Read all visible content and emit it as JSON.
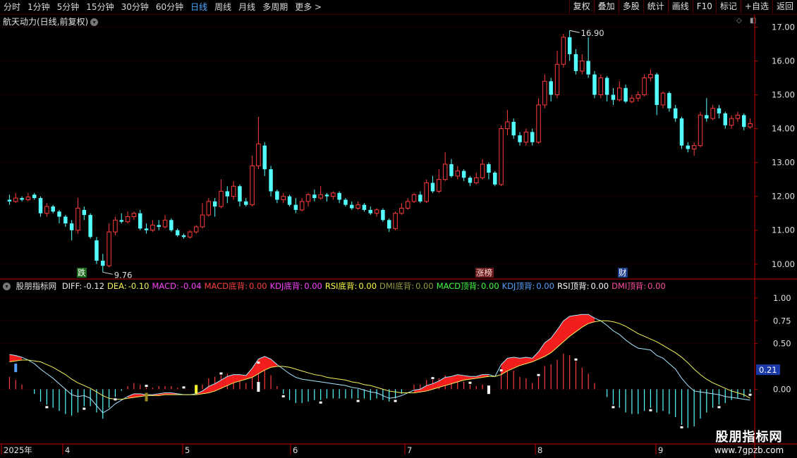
{
  "toolbar": {
    "periods": [
      "分时",
      "1分钟",
      "5分钟",
      "15分钟",
      "30分钟",
      "60分钟",
      "日线",
      "周线",
      "月线",
      "多周期",
      "更多 >"
    ],
    "active_period": "日线",
    "buttons": [
      "复权",
      "叠加",
      "多股",
      "统计",
      "画线",
      "F10",
      "标记",
      "+自选",
      "返回"
    ]
  },
  "stock": {
    "title": "航天动力(日线,前复权)"
  },
  "colors": {
    "up": "#ff3b3b",
    "down": "#54ffff",
    "diff": "#e8e8e8",
    "dea": "#f3f35a",
    "grid": "#5a0000",
    "axis": "#c00000"
  },
  "main_axis": {
    "ticks": [
      "17.00",
      "16.00",
      "15.00",
      "14.00",
      "13.00",
      "12.00",
      "11.00",
      "10.00"
    ]
  },
  "annotations": {
    "high_label": "16.90",
    "low_label": "9.76",
    "tag_die": "跌",
    "tag_zhangbang": "涨榜",
    "tag_cai": "财"
  },
  "indicator": {
    "name": "股朋指标网",
    "items": [
      {
        "label": "DIFF:",
        "value": "-0.12",
        "color": "#e8e8e8"
      },
      {
        "label": "DEA:",
        "value": "-0.10",
        "color": "#f3f35a"
      },
      {
        "label": "MACD:",
        "value": "-0.04",
        "color": "#ff44ff"
      },
      {
        "label": "MACD底背:",
        "value": "0.00",
        "color": "#ff4040"
      },
      {
        "label": "KDJ底背:",
        "value": "0.00",
        "color": "#ff44ff"
      },
      {
        "label": "RSI底背:",
        "value": "0.00",
        "color": "#ffff44"
      },
      {
        "label": "DMI底背:",
        "value": "0.00",
        "color": "#999944"
      },
      {
        "label": "MACD顶背:",
        "value": "0.00",
        "color": "#44ff44"
      },
      {
        "label": "KDJ顶背:",
        "value": "0.00",
        "color": "#5aa0ff"
      },
      {
        "label": "RSI顶背:",
        "value": "0.00",
        "color": "#ffffff"
      },
      {
        "label": "DMI顶背:",
        "value": "0.00",
        "color": "#ff4fa0"
      }
    ],
    "axis_ticks": [
      "1.00",
      "0.75",
      "0.50",
      "0.00"
    ],
    "current_value": "0.21"
  },
  "time_axis": {
    "labels": [
      "2025年",
      "4",
      "5",
      "6",
      "7",
      "8",
      "9"
    ]
  },
  "watermark": {
    "title": "股朋指标网",
    "url": "www.7gpzb.com"
  },
  "chart_data": {
    "type": "candlestick",
    "price_range": [
      9.6,
      17.3
    ],
    "indicator_range": [
      -0.6,
      1.1
    ],
    "candles": [
      [
        11.9,
        11.85,
        12.05,
        11.75
      ],
      [
        11.85,
        11.95,
        12.1,
        11.8
      ],
      [
        11.95,
        11.9,
        12.0,
        11.85
      ],
      [
        11.9,
        11.98,
        12.1,
        11.85
      ],
      [
        12.05,
        11.95,
        12.1,
        11.9
      ],
      [
        11.95,
        11.5,
        12.0,
        11.4
      ],
      [
        11.5,
        11.7,
        11.8,
        11.4
      ],
      [
        11.7,
        11.55,
        11.75,
        11.5
      ],
      [
        11.55,
        11.4,
        11.6,
        11.2
      ],
      [
        11.4,
        11.2,
        11.45,
        11.1
      ],
      [
        11.2,
        11.0,
        11.3,
        10.7
      ],
      [
        11.0,
        11.65,
        11.95,
        10.9
      ],
      [
        11.6,
        11.45,
        11.7,
        11.3
      ],
      [
        11.45,
        10.8,
        11.5,
        10.75
      ],
      [
        10.7,
        10.1,
        10.8,
        10.0
      ],
      [
        10.1,
        9.95,
        10.3,
        9.76
      ],
      [
        9.95,
        10.95,
        11.2,
        9.9
      ],
      [
        10.95,
        11.3,
        11.4,
        10.85
      ],
      [
        11.3,
        11.25,
        11.5,
        11.2
      ],
      [
        11.25,
        11.4,
        11.55,
        11.2
      ],
      [
        11.4,
        11.5,
        11.55,
        11.3
      ],
      [
        11.5,
        11.05,
        11.6,
        11.0
      ],
      [
        11.05,
        11.0,
        11.2,
        10.9
      ],
      [
        11.0,
        11.15,
        11.3,
        10.95
      ],
      [
        11.15,
        11.1,
        11.3,
        11.0
      ],
      [
        11.1,
        11.3,
        11.45,
        11.05
      ],
      [
        11.3,
        11.0,
        11.35,
        10.95
      ],
      [
        11.0,
        10.85,
        11.05,
        10.8
      ],
      [
        10.85,
        10.8,
        10.9,
        10.75
      ],
      [
        10.8,
        10.95,
        11.0,
        10.75
      ],
      [
        10.95,
        11.1,
        11.15,
        10.9
      ],
      [
        11.1,
        11.45,
        11.8,
        11.05
      ],
      [
        11.45,
        11.85,
        11.95,
        11.4
      ],
      [
        11.85,
        11.7,
        11.95,
        11.4
      ],
      [
        11.7,
        12.15,
        12.5,
        11.65
      ],
      [
        12.15,
        12.0,
        12.3,
        11.8
      ],
      [
        12.0,
        12.3,
        12.45,
        11.9
      ],
      [
        12.3,
        11.85,
        12.35,
        11.7
      ],
      [
        11.85,
        11.75,
        11.95,
        11.7
      ],
      [
        11.75,
        12.9,
        13.2,
        11.7
      ],
      [
        12.9,
        13.55,
        14.35,
        12.8
      ],
      [
        13.5,
        12.8,
        13.6,
        12.6
      ],
      [
        12.8,
        12.15,
        12.9,
        12.0
      ],
      [
        12.15,
        11.9,
        12.2,
        11.8
      ],
      [
        11.9,
        12.0,
        12.1,
        11.8
      ],
      [
        12.0,
        11.75,
        12.05,
        11.7
      ],
      [
        11.75,
        11.6,
        11.95,
        11.5
      ],
      [
        11.6,
        11.85,
        11.95,
        11.55
      ],
      [
        11.85,
        12.05,
        12.1,
        11.7
      ],
      [
        12.05,
        11.95,
        12.2,
        11.85
      ],
      [
        11.95,
        12.05,
        12.3,
        11.9
      ],
      [
        12.05,
        12.0,
        12.1,
        11.85
      ],
      [
        12.0,
        12.1,
        12.15,
        11.9
      ],
      [
        12.1,
        11.9,
        12.15,
        11.8
      ],
      [
        11.9,
        11.75,
        11.95,
        11.7
      ],
      [
        11.75,
        11.65,
        11.85,
        11.6
      ],
      [
        11.65,
        11.75,
        11.85,
        11.6
      ],
      [
        11.75,
        11.6,
        11.8,
        11.55
      ],
      [
        11.6,
        11.5,
        11.7,
        11.45
      ],
      [
        11.5,
        11.6,
        11.65,
        11.4
      ],
      [
        11.6,
        11.3,
        11.65,
        11.25
      ],
      [
        11.3,
        11.05,
        11.35,
        10.95
      ],
      [
        11.05,
        11.5,
        11.55,
        11.0
      ],
      [
        11.5,
        11.65,
        11.8,
        11.45
      ],
      [
        11.65,
        11.85,
        11.95,
        11.6
      ],
      [
        11.85,
        12.05,
        12.1,
        11.8
      ],
      [
        12.05,
        11.85,
        12.15,
        11.8
      ],
      [
        11.85,
        12.4,
        12.5,
        11.8
      ],
      [
        12.4,
        12.15,
        12.6,
        12.1
      ],
      [
        12.15,
        12.5,
        12.8,
        12.1
      ],
      [
        12.5,
        12.95,
        13.3,
        12.45
      ],
      [
        12.95,
        12.6,
        13.1,
        12.55
      ],
      [
        12.6,
        12.75,
        12.9,
        12.5
      ],
      [
        12.75,
        12.55,
        12.8,
        12.45
      ],
      [
        12.55,
        12.4,
        12.6,
        12.3
      ],
      [
        12.4,
        12.55,
        12.7,
        12.35
      ],
      [
        12.55,
        12.95,
        13.1,
        12.5
      ],
      [
        12.95,
        12.7,
        13.0,
        12.5
      ],
      [
        12.7,
        12.35,
        12.75,
        12.3
      ],
      [
        12.35,
        14.0,
        14.1,
        12.3
      ],
      [
        14.0,
        14.2,
        14.55,
        13.8
      ],
      [
        14.2,
        13.8,
        14.3,
        13.7
      ],
      [
        13.8,
        13.6,
        13.9,
        13.5
      ],
      [
        13.6,
        13.9,
        14.0,
        13.5
      ],
      [
        13.9,
        13.6,
        14.0,
        13.5
      ],
      [
        13.6,
        14.7,
        14.9,
        13.55
      ],
      [
        14.7,
        15.4,
        15.6,
        14.6
      ],
      [
        15.4,
        15.0,
        15.5,
        14.8
      ],
      [
        15.0,
        15.9,
        16.3,
        14.9
      ],
      [
        15.9,
        16.7,
        16.8,
        15.8
      ],
      [
        16.7,
        16.2,
        16.9,
        16.0
      ],
      [
        16.2,
        15.7,
        16.35,
        15.6
      ],
      [
        15.7,
        16.0,
        16.2,
        15.6
      ],
      [
        16.0,
        15.6,
        16.7,
        15.5
      ],
      [
        15.6,
        15.0,
        15.7,
        14.9
      ],
      [
        15.0,
        15.5,
        15.6,
        14.9
      ],
      [
        15.5,
        15.0,
        15.55,
        14.8
      ],
      [
        15.0,
        14.85,
        15.2,
        14.7
      ],
      [
        14.85,
        15.2,
        15.4,
        14.8
      ],
      [
        15.2,
        14.8,
        15.3,
        14.75
      ],
      [
        14.8,
        14.9,
        15.0,
        14.75
      ],
      [
        14.9,
        15.0,
        15.1,
        14.8
      ],
      [
        15.0,
        15.5,
        15.6,
        14.95
      ],
      [
        15.5,
        15.6,
        15.75,
        15.4
      ],
      [
        15.6,
        14.7,
        15.65,
        14.4
      ],
      [
        14.7,
        15.05,
        15.1,
        14.6
      ],
      [
        15.05,
        14.6,
        15.1,
        14.5
      ],
      [
        14.6,
        14.3,
        14.7,
        14.2
      ],
      [
        14.3,
        13.5,
        14.35,
        13.4
      ],
      [
        13.5,
        13.4,
        13.6,
        13.3
      ],
      [
        13.4,
        13.5,
        13.6,
        13.2
      ],
      [
        13.5,
        14.4,
        14.5,
        13.45
      ],
      [
        14.4,
        14.3,
        14.9,
        14.2
      ],
      [
        14.3,
        14.6,
        14.7,
        14.25
      ],
      [
        14.6,
        14.45,
        14.7,
        14.3
      ],
      [
        14.45,
        14.1,
        14.5,
        14.0
      ],
      [
        14.1,
        14.3,
        14.4,
        14.0
      ],
      [
        14.3,
        14.4,
        14.5,
        14.2
      ],
      [
        14.4,
        14.05,
        14.45,
        13.95
      ],
      [
        14.05,
        14.15,
        14.3,
        14.0
      ]
    ],
    "diff": [
      0.38,
      0.37,
      0.35,
      0.32,
      0.28,
      0.22,
      0.17,
      0.12,
      0.06,
      0.0,
      -0.06,
      -0.08,
      -0.07,
      -0.1,
      -0.18,
      -0.26,
      -0.22,
      -0.16,
      -0.12,
      -0.08,
      -0.05,
      -0.05,
      -0.06,
      -0.06,
      -0.05,
      -0.04,
      -0.04,
      -0.05,
      -0.06,
      -0.06,
      -0.05,
      -0.02,
      0.03,
      0.06,
      0.1,
      0.14,
      0.16,
      0.16,
      0.15,
      0.23,
      0.33,
      0.36,
      0.33,
      0.27,
      0.22,
      0.17,
      0.13,
      0.11,
      0.1,
      0.09,
      0.08,
      0.07,
      0.06,
      0.05,
      0.04,
      0.02,
      0.01,
      -0.01,
      -0.03,
      -0.04,
      -0.07,
      -0.1,
      -0.09,
      -0.07,
      -0.04,
      -0.01,
      0.0,
      0.04,
      0.06,
      0.09,
      0.13,
      0.14,
      0.16,
      0.15,
      0.14,
      0.14,
      0.16,
      0.16,
      0.14,
      0.27,
      0.34,
      0.35,
      0.34,
      0.35,
      0.34,
      0.41,
      0.51,
      0.56,
      0.65,
      0.75,
      0.8,
      0.81,
      0.82,
      0.82,
      0.78,
      0.75,
      0.7,
      0.64,
      0.6,
      0.54,
      0.49,
      0.45,
      0.44,
      0.43,
      0.37,
      0.34,
      0.28,
      0.22,
      0.12,
      0.04,
      -0.02,
      -0.03,
      -0.04,
      -0.05,
      -0.06,
      -0.08,
      -0.09,
      -0.1,
      -0.11,
      -0.12
    ],
    "dea": [
      0.3,
      0.31,
      0.32,
      0.32,
      0.31,
      0.3,
      0.27,
      0.24,
      0.2,
      0.16,
      0.11,
      0.07,
      0.04,
      0.01,
      -0.03,
      -0.07,
      -0.1,
      -0.11,
      -0.11,
      -0.1,
      -0.09,
      -0.08,
      -0.07,
      -0.07,
      -0.07,
      -0.06,
      -0.06,
      -0.06,
      -0.06,
      -0.06,
      -0.06,
      -0.05,
      -0.04,
      -0.02,
      0.01,
      0.04,
      0.07,
      0.09,
      0.11,
      0.13,
      0.17,
      0.21,
      0.24,
      0.25,
      0.25,
      0.24,
      0.22,
      0.2,
      0.18,
      0.16,
      0.15,
      0.13,
      0.12,
      0.11,
      0.1,
      0.08,
      0.07,
      0.05,
      0.04,
      0.02,
      0.0,
      -0.02,
      -0.03,
      -0.04,
      -0.04,
      -0.04,
      -0.03,
      -0.02,
      0.0,
      0.02,
      0.04,
      0.06,
      0.08,
      0.1,
      0.11,
      0.12,
      0.13,
      0.14,
      0.14,
      0.16,
      0.2,
      0.23,
      0.26,
      0.28,
      0.3,
      0.33,
      0.36,
      0.4,
      0.46,
      0.52,
      0.58,
      0.63,
      0.68,
      0.72,
      0.74,
      0.75,
      0.75,
      0.74,
      0.72,
      0.69,
      0.65,
      0.61,
      0.58,
      0.55,
      0.52,
      0.48,
      0.44,
      0.4,
      0.35,
      0.29,
      0.22,
      0.16,
      0.11,
      0.07,
      0.04,
      0.01,
      -0.02,
      -0.04,
      -0.06,
      -0.1
    ]
  }
}
